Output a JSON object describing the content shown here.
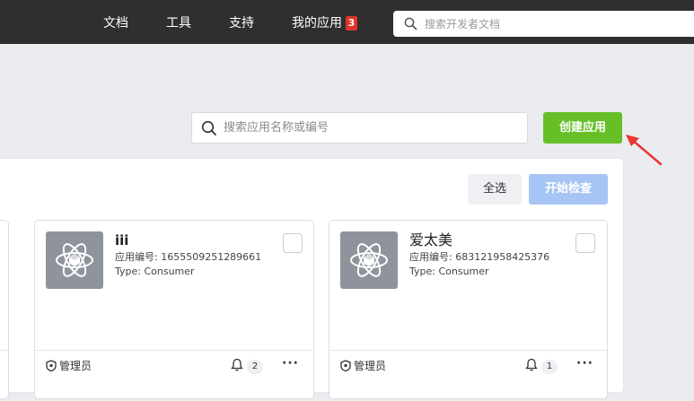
{
  "nav": {
    "items": [
      {
        "label": "文档"
      },
      {
        "label": "工具"
      },
      {
        "label": "支持"
      },
      {
        "label": "我的应用",
        "badge": "3"
      }
    ],
    "search_placeholder": "搜索开发者文档"
  },
  "toolbar": {
    "search_placeholder": "搜索应用名称或编号",
    "create_label": "创建应用"
  },
  "panel": {
    "select_all_label": "全选",
    "start_check_label": "开始检查"
  },
  "apps": [
    {
      "name": "iii",
      "id_text": "应用编号: 1655509251289661",
      "type_text": "Type: Consumer",
      "role": "管理员",
      "count": "2",
      "more": "···"
    },
    {
      "name": "爱太美",
      "id_text": "应用编号: 683121958425376",
      "type_text": "Type: Consumer",
      "role": "管理员",
      "count": "1",
      "more": "···"
    }
  ],
  "colors": {
    "topbar": "#2f2f30",
    "create_button": "#67bf28",
    "start_check_button": "#a7c5f4",
    "badge": "#e0332b",
    "annotation_arrow": "#e8382f"
  }
}
